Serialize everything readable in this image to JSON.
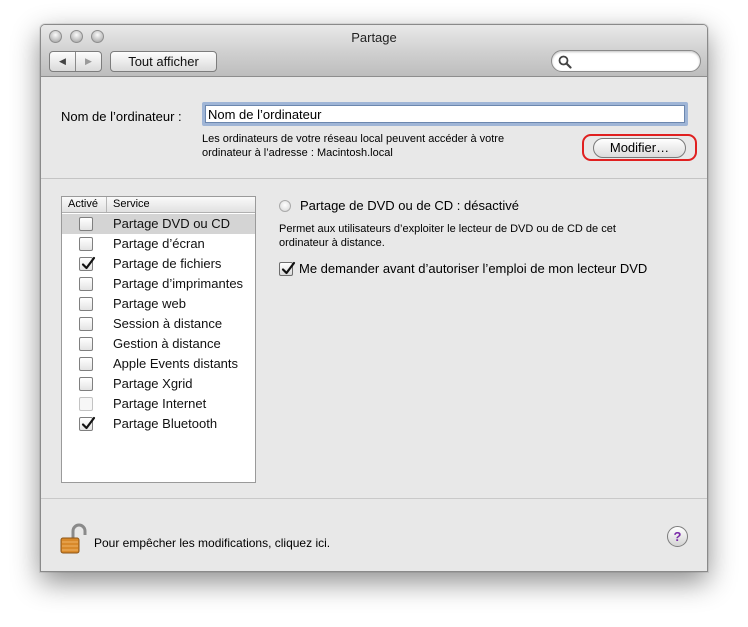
{
  "window": {
    "title": "Partage"
  },
  "toolbar": {
    "back_glyph": "◀",
    "forward_glyph": "▶",
    "show_all_label": "Tout afficher",
    "search_placeholder": ""
  },
  "computer": {
    "label": "Nom de l’ordinateur :",
    "value": "Nom de l’ordinateur",
    "description_line1": "Les ordinateurs de votre réseau local peuvent accéder à votre",
    "description_line2": "ordinateur à l’adresse : Macintosh.local",
    "modify_label": "Modifier…",
    "highlight_color": "#e02020"
  },
  "services": {
    "col_active": "Activé",
    "col_service": "Service",
    "items": [
      {
        "label": "Partage DVD ou CD",
        "checked": false,
        "selected": true,
        "enabled": true
      },
      {
        "label": "Partage d’écran",
        "checked": false,
        "selected": false,
        "enabled": true
      },
      {
        "label": "Partage de fichiers",
        "checked": true,
        "selected": false,
        "enabled": true
      },
      {
        "label": "Partage d’imprimantes",
        "checked": false,
        "selected": false,
        "enabled": true
      },
      {
        "label": "Partage web",
        "checked": false,
        "selected": false,
        "enabled": true
      },
      {
        "label": "Session à distance",
        "checked": false,
        "selected": false,
        "enabled": true
      },
      {
        "label": "Gestion à distance",
        "checked": false,
        "selected": false,
        "enabled": true
      },
      {
        "label": "Apple Events distants",
        "checked": false,
        "selected": false,
        "enabled": true
      },
      {
        "label": "Partage Xgrid",
        "checked": false,
        "selected": false,
        "enabled": true
      },
      {
        "label": "Partage Internet",
        "checked": false,
        "selected": false,
        "enabled": false
      },
      {
        "label": "Partage Bluetooth",
        "checked": true,
        "selected": false,
        "enabled": true
      }
    ]
  },
  "detail": {
    "status_title": "Partage de DVD ou de CD : désactivé",
    "description_line1": "Permet aux utilisateurs d’exploiter le lecteur de DVD ou de CD de cet",
    "description_line2": "ordinateur à distance.",
    "ask_label": "Me demander avant d’autoriser l’emploi de mon lecteur DVD",
    "ask_checked": true
  },
  "footer": {
    "lock_text": "Pour empêcher les modifications, cliquez ici.",
    "help_glyph": "?",
    "lock_icon": "lock-open-icon"
  }
}
